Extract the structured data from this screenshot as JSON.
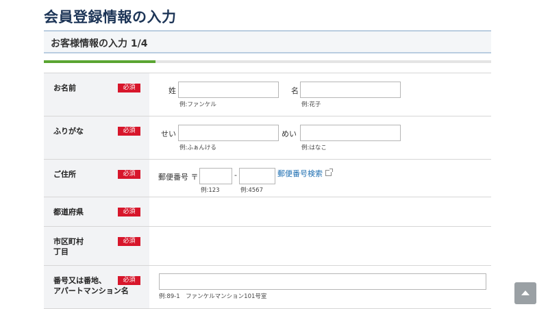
{
  "page": {
    "title": "会員登録情報の入力"
  },
  "section": {
    "title": "お客様情報の入力 1/4"
  },
  "progress": {
    "step": 1,
    "total": 4,
    "fraction": 0.25
  },
  "required_badge": "必須",
  "colors": {
    "accent": "#5aa532",
    "required": "#d7162b",
    "link": "#1f6fb2",
    "title": "#1d3557"
  },
  "rows": {
    "name": {
      "label": "お名前",
      "last_label": "姓",
      "last_value": "",
      "last_hint": "例:ファンケル",
      "first_label": "名",
      "first_value": "",
      "first_hint": "例:花子"
    },
    "kana": {
      "label": "ふりがな",
      "last_label": "せい",
      "last_value": "",
      "last_hint": "例:ふぁんける",
      "first_label": "めい",
      "first_value": "",
      "first_hint": "例:はなこ"
    },
    "address": {
      "label": "ご住所",
      "postal_label": "郵便番号 〒",
      "postal1_value": "",
      "postal1_hint": "例:123",
      "dash": "-",
      "postal2_value": "",
      "postal2_hint": "例:4567",
      "search_link": "郵便番号検索",
      "search_icon": "external-link-icon"
    },
    "prefecture": {
      "label": "都道府県"
    },
    "city": {
      "label_line1": "市区町村",
      "label_line2": "丁目"
    },
    "street": {
      "label_line1": "番号又は番地、",
      "label_line2": "アパートマンション名",
      "value": "",
      "hint": "例:89-1　ファンケルマンション101号室"
    }
  },
  "scroll_top": {
    "icon": "arrow-up-icon"
  }
}
